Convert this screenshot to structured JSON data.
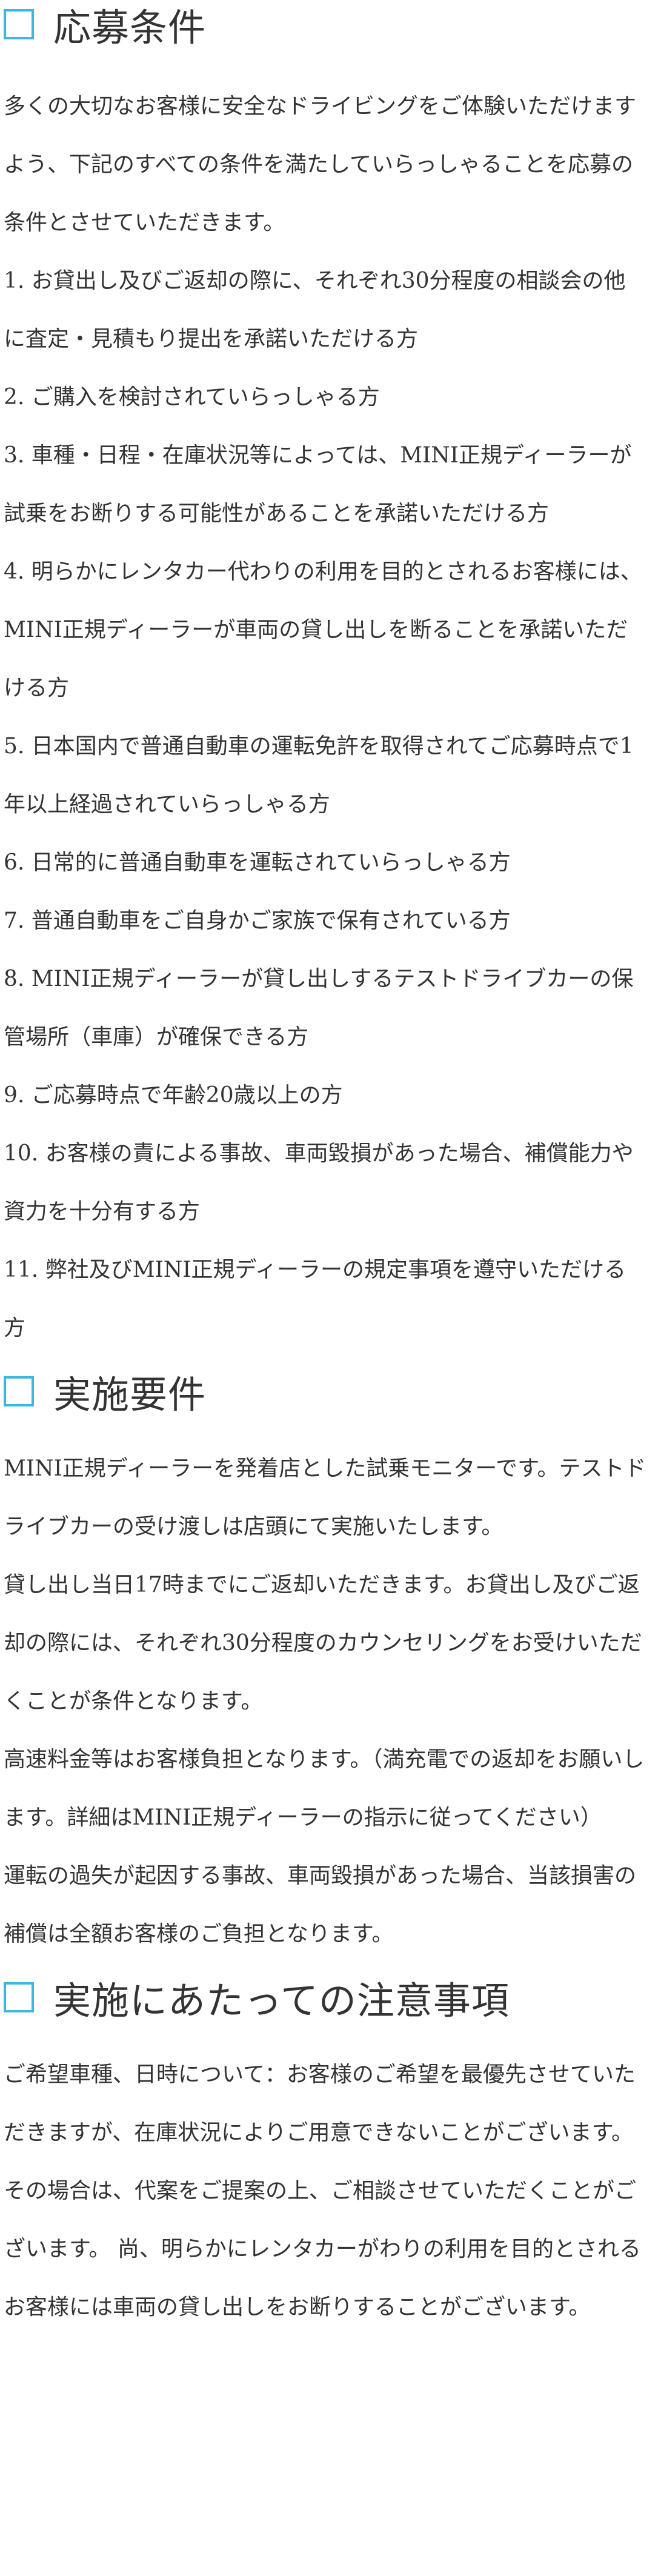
{
  "section1": {
    "heading": "応募条件",
    "intro": "多くの大切なお客様に安全なドライビングをご体験いただけますよう、下記のすべての条件を満たしていらっしゃることを応募の条件とさせていただきます。",
    "items": [
      "1. お貸出し及びご返却の際に、それぞれ30分程度の相談会の他に査定・見積もり提出を承諾いただける方",
      "2. ご購入を検討されていらっしゃる方",
      "3. 車種・日程・在庫状況等によっては、MINI正規ディーラーが試乗をお断りする可能性があることを承諾いただける方",
      "4. 明らかにレンタカー代わりの利用を目的とされるお客様には、MINI正規ディーラーが車両の貸し出しを断ることを承諾いただける方",
      "5. 日本国内で普通自動車の運転免許を取得されてご応募時点で1年以上経過されていらっしゃる方",
      "6. 日常的に普通自動車を運転されていらっしゃる方",
      "7. 普通自動車をご自身かご家族で保有されている方",
      "8. MINI正規ディーラーが貸し出しするテストドライブカーの保管場所（車庫）が確保できる方",
      "9. ご応募時点で年齢20歳以上の方",
      "10. お客様の責による事故、車両毀損があった場合、補償能力や資力を十分有する方",
      "11. 弊社及びMINI正規ディーラーの規定事項を遵守いただける方"
    ]
  },
  "section2": {
    "heading": "実施要件",
    "paragraphs": [
      "MINI正規ディーラーを発着店とした試乗モニターです。テストドライブカーの受け渡しは店頭にて実施いたします。",
      "貸し出し当日17時までにご返却いただきます。お貸出し及びご返却の際には、それぞれ30分程度のカウンセリングをお受けいただくことが条件となります。",
      "高速料金等はお客様負担となります。（満充電での返却をお願いします。詳細はMINI正規ディーラーの指示に従ってください）",
      "運転の過失が起因する事故、車両毀損があった場合、当該損害の補償は全額お客様のご負担となります。"
    ]
  },
  "section3": {
    "heading": "実施にあたっての注意事項",
    "paragraphs": [
      "ご希望車種、日時について：お客様のご希望を最優先させていただきますが、在庫状況によりご用意できないことがございます。",
      "その場合は、代案をご提案の上、ご相談させていただくことがございます。 尚、明らかにレンタカーがわりの利用を目的とされるお客様には車両の貸し出しをお断りすることがございます。"
    ]
  },
  "colors": {
    "accent": "#3ab8e0",
    "text": "#333333",
    "background": "#ffffff"
  }
}
